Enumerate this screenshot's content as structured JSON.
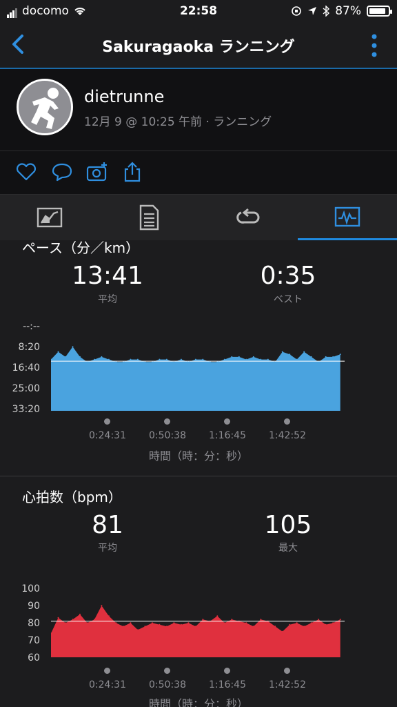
{
  "status": {
    "carrier": "docomo",
    "time": "22:58",
    "battery": "87%",
    "battery_level": 0.87
  },
  "nav": {
    "title": "Sakuragaoka ランニング"
  },
  "profile": {
    "username": "dietrunne",
    "meta": "12月 9 @ 10:25 午前 · ランニング"
  },
  "tabs": [
    "chart-tab",
    "details-tab",
    "laps-tab",
    "graphs-tab"
  ],
  "pace": {
    "title": "ペース（分／km）",
    "avg_value": "13:41",
    "avg_label": "平均",
    "best_value": "0:35",
    "best_label": "ベスト",
    "y_ticks": [
      "--:--",
      "8:20",
      "16:40",
      "25:00",
      "33:20"
    ],
    "x_ticks": [
      "0:24:31",
      "0:50:38",
      "1:16:45",
      "1:42:52"
    ],
    "x_title": "時間（時：分：秒）"
  },
  "heart": {
    "title": "心拍数（bpm）",
    "avg_value": "81",
    "avg_label": "平均",
    "max_value": "105",
    "max_label": "最大",
    "y_ticks": [
      "100",
      "90",
      "80",
      "70",
      "60"
    ],
    "x_ticks": [
      "0:24:31",
      "0:50:38",
      "1:16:45",
      "1:42:52"
    ],
    "x_title": "時間（時：分：秒）"
  },
  "colors": {
    "accent": "#1f8ae0",
    "pace": "#4aa3df",
    "heart": "#e0303e"
  },
  "chart_data": [
    {
      "type": "area",
      "ylabel": "ペース（分／km）",
      "ylim": [
        0,
        33.33
      ],
      "y_reversed": true,
      "y_unit": "minutes per km",
      "xlim": [
        0,
        2.03
      ],
      "x_unit": "hours",
      "average_line": 13.68,
      "x": [
        0,
        0.05,
        0.1,
        0.15,
        0.2,
        0.25,
        0.3,
        0.35,
        0.4,
        0.45,
        0.5,
        0.55,
        0.6,
        0.65,
        0.7,
        0.75,
        0.8,
        0.85,
        0.9,
        0.95,
        1.0,
        1.05,
        1.1,
        1.15,
        1.2,
        1.25,
        1.3,
        1.35,
        1.4,
        1.45,
        1.5,
        1.55,
        1.6,
        1.65,
        1.7,
        1.75,
        1.8,
        1.85,
        1.9,
        1.95,
        2.0
      ],
      "values": [
        13,
        10,
        12,
        8,
        12,
        14,
        13,
        12,
        13,
        14,
        14,
        13,
        13,
        14,
        14,
        13,
        13,
        14,
        13,
        14,
        13,
        13,
        14,
        14,
        13,
        12,
        12,
        13,
        12,
        13,
        13,
        14,
        10,
        11,
        13,
        10,
        12,
        14,
        12,
        12,
        11
      ]
    },
    {
      "type": "area",
      "ylabel": "心拍数（bpm）",
      "ylim": [
        60,
        105
      ],
      "xlim": [
        0,
        2.03
      ],
      "x_unit": "hours",
      "average_line": 81,
      "x": [
        0,
        0.05,
        0.1,
        0.15,
        0.2,
        0.25,
        0.3,
        0.35,
        0.4,
        0.45,
        0.5,
        0.55,
        0.6,
        0.65,
        0.7,
        0.75,
        0.8,
        0.85,
        0.9,
        0.95,
        1.0,
        1.05,
        1.1,
        1.15,
        1.2,
        1.25,
        1.3,
        1.35,
        1.4,
        1.45,
        1.5,
        1.55,
        1.6,
        1.65,
        1.7,
        1.75,
        1.8,
        1.85,
        1.9,
        1.95,
        2.0
      ],
      "values": [
        74,
        83,
        80,
        82,
        85,
        80,
        82,
        90,
        84,
        80,
        78,
        80,
        76,
        78,
        80,
        79,
        78,
        80,
        79,
        80,
        78,
        82,
        81,
        84,
        80,
        82,
        81,
        80,
        78,
        82,
        81,
        78,
        75,
        79,
        80,
        78,
        80,
        82,
        79,
        80,
        82
      ]
    }
  ]
}
